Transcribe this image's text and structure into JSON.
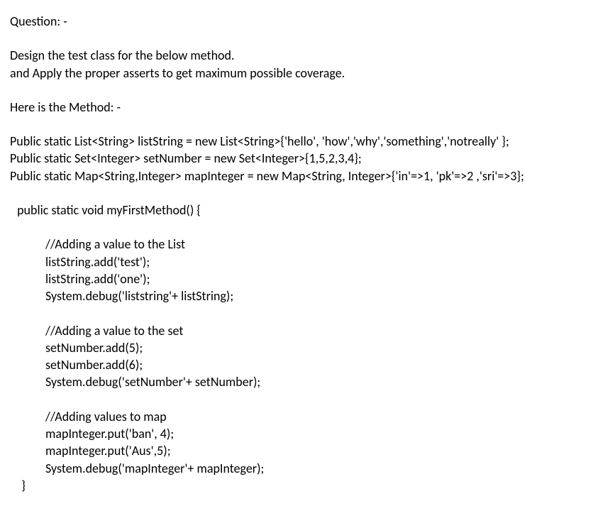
{
  "doc": {
    "q_label": "Question: -",
    "intro_line1": "Design the test class for the below method.",
    "intro_line2": "and Apply the proper asserts to get maximum possible coverage.",
    "method_label": "Here is the Method: -",
    "decl1": "Public static List<String> listString = new List<String>{'hello', 'how','why','something','notreally' };",
    "decl2": "Public static Set<Integer> setNumber = new Set<Integer>{1,5,2,3,4};",
    "decl3": "Public static Map<String,Integer> mapInteger = new Map<String, Integer>{'in'=>1, 'pk'=>2 ,'sri'=>3};",
    "method_sig": " public static void myFirstMethod() {",
    "comment_list": "//Adding a value to the List",
    "list_add1": "listString.add('test');",
    "list_add2": "listString.add('one');",
    "list_debug": "System.debug('liststring'+ listString);",
    "comment_set": "//Adding a value to the set",
    "set_add1": "setNumber.add(5);",
    "set_add2": "setNumber.add(6);",
    "set_debug": "System.debug('setNumber'+ setNumber);",
    "comment_map": "//Adding values to map",
    "map_put1": "mapInteger.put('ban', 4);",
    "map_put2": "mapInteger.put('Aus',5);",
    "map_debug": "System.debug('mapInteger'+ mapInteger);",
    "close_brace": "    }"
  }
}
